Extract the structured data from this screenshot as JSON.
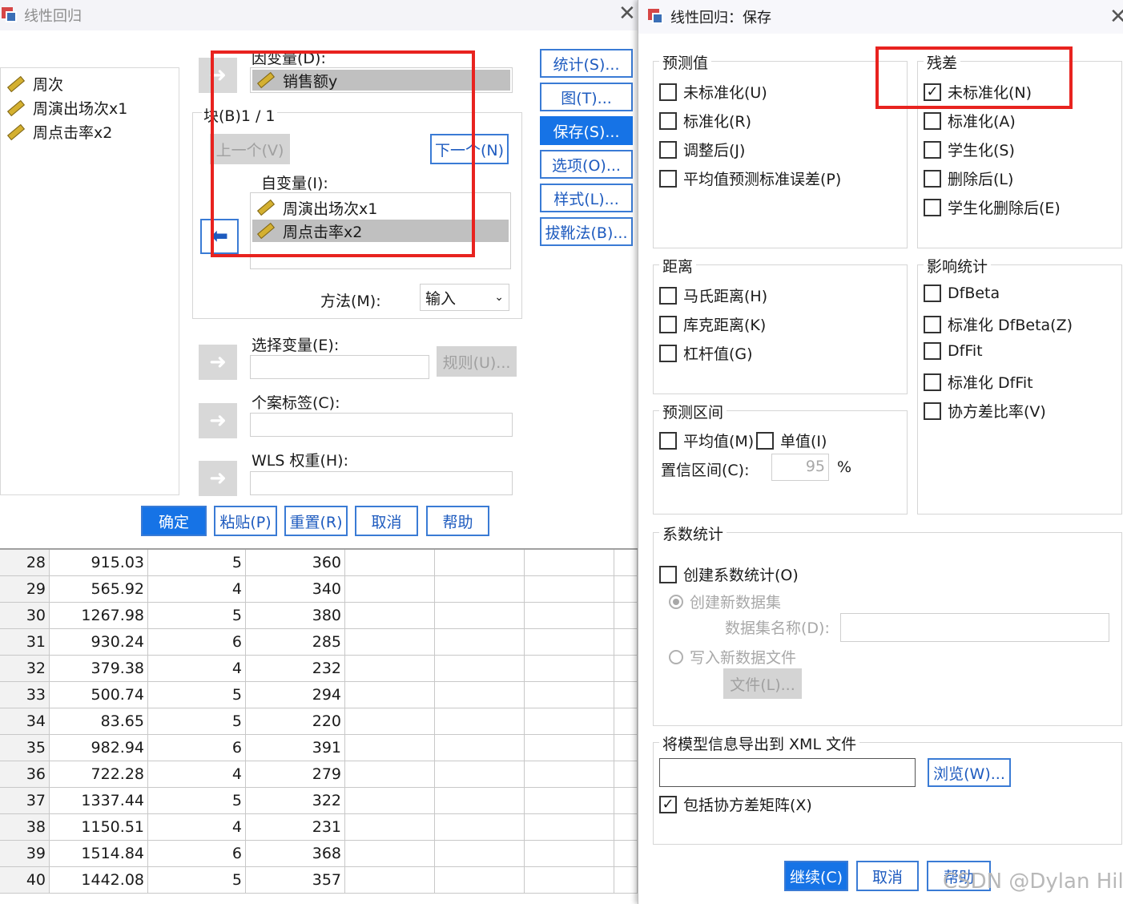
{
  "main_dialog": {
    "title": "线性回归",
    "close_glyph": "✕",
    "variables": [
      "周次",
      "周演出场次x1",
      "周点击率x2"
    ],
    "dependent_label": "因变量(D):",
    "dependent_value": "销售额y",
    "block_label": "块(B)1 / 1",
    "prev_button": "上一个(V)",
    "next_button": "下一个(N)",
    "independent_label": "自变量(I):",
    "independents": [
      "周演出场次x1",
      "周点击率x2"
    ],
    "method_label": "方法(M):",
    "method_value": "输入",
    "selection_label": "选择变量(E):",
    "rule_button": "规则(U)...",
    "case_label": "个案标签(C):",
    "wls_label": "WLS 权重(H):",
    "side_buttons": [
      "统计(S)...",
      "图(T)...",
      "保存(S)...",
      "选项(O)...",
      "样式(L)...",
      "拔靴法(B)..."
    ],
    "bottom_buttons": [
      "确定",
      "粘贴(P)",
      "重置(R)",
      "取消",
      "帮助"
    ]
  },
  "grid": {
    "rows": [
      [
        "28",
        "915.03",
        "5",
        "360"
      ],
      [
        "29",
        "565.92",
        "4",
        "340"
      ],
      [
        "30",
        "1267.98",
        "5",
        "380"
      ],
      [
        "31",
        "930.24",
        "6",
        "285"
      ],
      [
        "32",
        "379.38",
        "4",
        "232"
      ],
      [
        "33",
        "500.74",
        "5",
        "294"
      ],
      [
        "34",
        "83.65",
        "5",
        "220"
      ],
      [
        "35",
        "982.94",
        "6",
        "391"
      ],
      [
        "36",
        "722.28",
        "4",
        "279"
      ],
      [
        "37",
        "1337.44",
        "5",
        "322"
      ],
      [
        "38",
        "1150.51",
        "4",
        "231"
      ],
      [
        "39",
        "1514.84",
        "6",
        "368"
      ],
      [
        "40",
        "1442.08",
        "5",
        "357"
      ]
    ]
  },
  "save_dialog": {
    "title": "线性回归：保存",
    "close_glyph": "✕",
    "predicted": {
      "title": "预测值",
      "items": [
        {
          "label": "未标准化(U)",
          "checked": false
        },
        {
          "label": "标准化(R)",
          "checked": false
        },
        {
          "label": "调整后(J)",
          "checked": false
        },
        {
          "label": "平均值预测标准误差(P)",
          "checked": false
        }
      ]
    },
    "residuals": {
      "title": "残差",
      "items": [
        {
          "label": "未标准化(N)",
          "checked": true
        },
        {
          "label": "标准化(A)",
          "checked": false
        },
        {
          "label": "学生化(S)",
          "checked": false
        },
        {
          "label": "删除后(L)",
          "checked": false
        },
        {
          "label": "学生化删除后(E)",
          "checked": false
        }
      ]
    },
    "distances": {
      "title": "距离",
      "items": [
        {
          "label": "马氏距离(H)",
          "checked": false
        },
        {
          "label": "库克距离(K)",
          "checked": false
        },
        {
          "label": "杠杆值(G)",
          "checked": false
        }
      ]
    },
    "influence": {
      "title": "影响统计",
      "items": [
        {
          "label": "DfBeta",
          "checked": false
        },
        {
          "label": "标准化 DfBeta(Z)",
          "checked": false
        },
        {
          "label": "DfFit",
          "checked": false
        },
        {
          "label": "标准化 DfFit",
          "checked": false
        },
        {
          "label": "协方差比率(V)",
          "checked": false
        }
      ]
    },
    "interval": {
      "title": "预测区间",
      "mean": "平均值(M)",
      "individual": "单值(I)",
      "ci_label": "置信区间(C):",
      "ci_value": "95",
      "percent": "%"
    },
    "coef": {
      "title": "系数统计",
      "create": "创建系数统计(O)",
      "new_dataset": "创建新数据集",
      "dataset_name": "数据集名称(D):",
      "write_file": "写入新数据文件",
      "file_button": "文件(L)..."
    },
    "xml": {
      "title": "将模型信息导出到 XML 文件",
      "browse": "浏览(W)...",
      "include": "包括协方差矩阵(X)",
      "include_checked": true
    },
    "buttons": [
      "继续(C)",
      "取消",
      "帮助"
    ],
    "watermark": "CSDN @Dylan Hill"
  },
  "colors": {
    "accent": "#1673e6",
    "highlight": "#e8231f"
  }
}
